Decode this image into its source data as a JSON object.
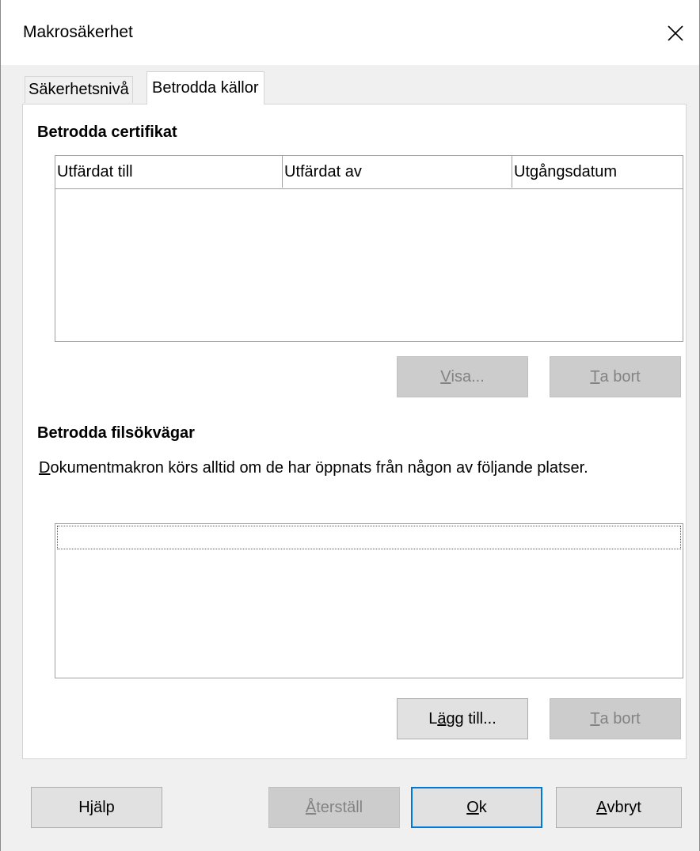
{
  "window": {
    "title": "Makrosäkerhet"
  },
  "tabs": [
    {
      "label": "Säkerhetsnivå",
      "active": false
    },
    {
      "label": "Betrodda källor",
      "active": true
    }
  ],
  "certificates": {
    "title": "Betrodda certifikat",
    "columns": [
      "Utfärdat till",
      "Utfärdat av",
      "Utgångsdatum"
    ],
    "rows": [],
    "view_button": {
      "mnemonic": "V",
      "rest": "isa...",
      "enabled": false
    },
    "remove_button": {
      "mnemonic": "T",
      "rest": "a bort",
      "enabled": false
    }
  },
  "paths": {
    "title": "Betrodda filsökvägar",
    "description_mnemonic": "D",
    "description_rest": "okumentmakron körs alltid om de har öppnats från någon av följande platser.",
    "items": [],
    "add_button": {
      "pre": "L",
      "mnemonic": "ä",
      "rest": "gg till...",
      "enabled": true
    },
    "remove_button": {
      "mnemonic": "T",
      "rest": "a bort",
      "enabled": false
    }
  },
  "footer": {
    "help": {
      "pre": "H",
      "mnemonic": "j",
      "rest": "älp"
    },
    "reset": {
      "mnemonic": "Å",
      "rest": "terställ",
      "enabled": false
    },
    "ok": {
      "mnemonic": "O",
      "rest": "k"
    },
    "cancel": {
      "mnemonic": "A",
      "rest": "vbryt"
    }
  },
  "colors": {
    "dialog_bg": "#f0f0f0",
    "panel_bg": "#ffffff",
    "default_button_border": "#0078d7",
    "disabled_text": "#838383"
  }
}
